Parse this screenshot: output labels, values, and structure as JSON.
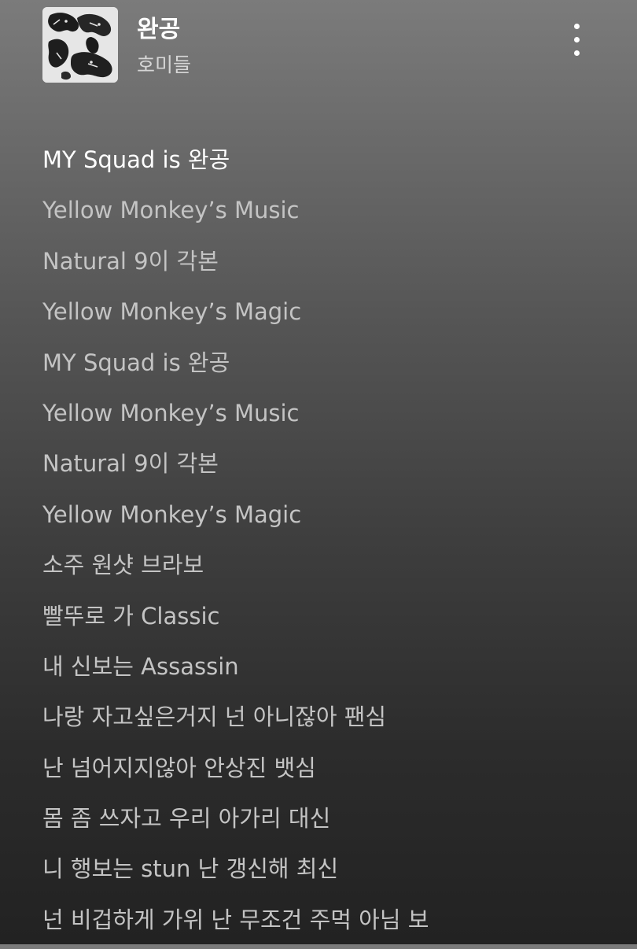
{
  "song": {
    "title": "완공",
    "artist": "호미들"
  },
  "header": {
    "album_art_icon": "album-art",
    "more_icon": "more-vertical-icon"
  },
  "lyrics": {
    "active_index": 0,
    "lines": [
      "MY Squad is 완공",
      "Yellow Monkey’s Music",
      "Natural 9이 각본",
      "Yellow Monkey’s Magic",
      "MY Squad is 완공",
      "Yellow Monkey’s Music",
      "Natural 9이 각본",
      "Yellow Monkey’s Magic",
      "소주 원샷 브라보",
      "빨뚜로 가 Classic",
      "내 신보는 Assassin",
      "나랑 자고싶은거지 넌 아니잖아 팬심",
      "난 넘어지지않아 안상진 뱃심",
      "몸 좀 쓰자고 우리 아가리 대신",
      "니 행보는 stun 난 갱신해 최신",
      "넌 비겁하게 가위 난 무조건 주먹 아님 보"
    ]
  },
  "colors": {
    "active_lyric": "#ffffff",
    "inactive_lyric": "#c4c4c4",
    "artist_text": "#d6d6d6"
  }
}
